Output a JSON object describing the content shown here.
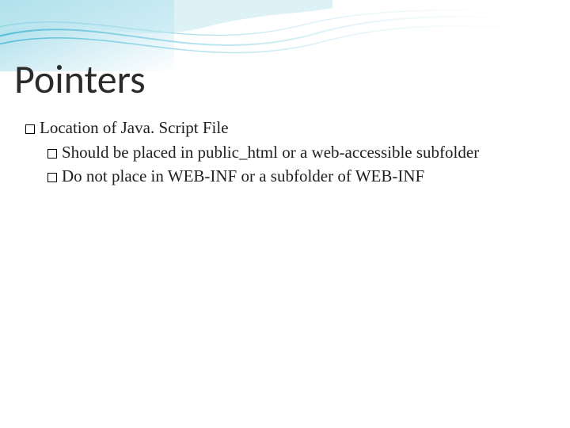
{
  "slide": {
    "title": "Pointers",
    "bullet1": "Location of Java. Script File",
    "bullet1a": "Should be placed in public_html or a web-accessible subfolder",
    "bullet1b": "Do not place in WEB-INF or a subfolder of WEB-INF"
  }
}
